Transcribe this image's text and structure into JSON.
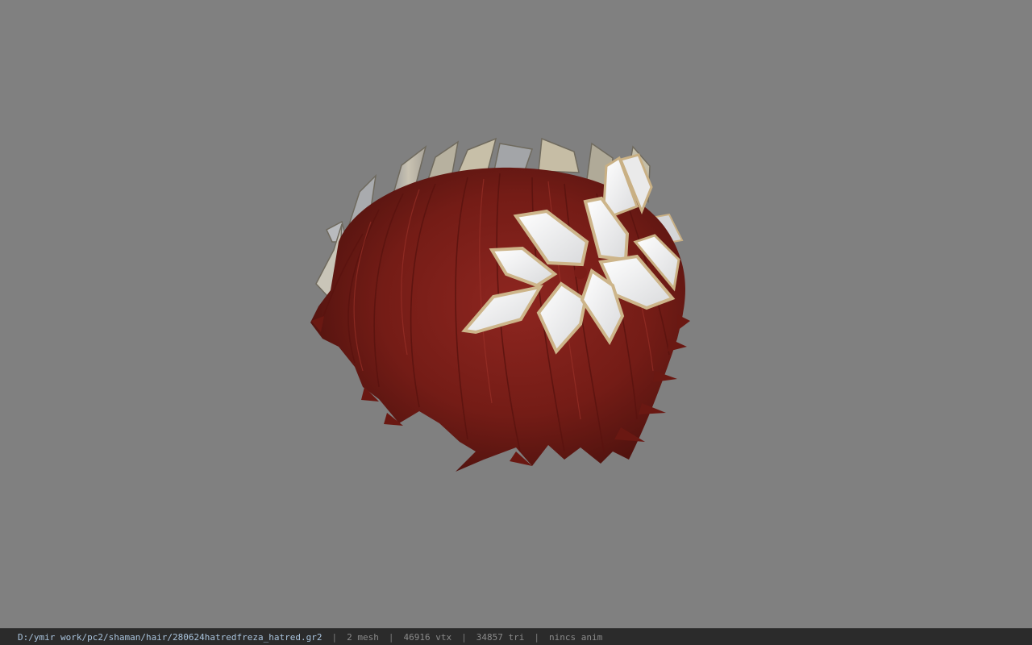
{
  "viewport": {
    "background_color": "#808080",
    "model": {
      "hair_color": "#7c1d17",
      "petal_color": "#f2f2f0",
      "petal_edge_color": "#cdb58a",
      "crown_leaf_color": "#b8b2a2"
    }
  },
  "status_bar": {
    "file_path": "D:/ymir work/pc2/shaman/hair/280624hatredfreza_hatred.gr2",
    "separator": "|",
    "mesh_count": "2 mesh",
    "vertex_count": "46916 vtx",
    "triangle_count": "34857 tri",
    "anim_status": "nincs anim"
  }
}
